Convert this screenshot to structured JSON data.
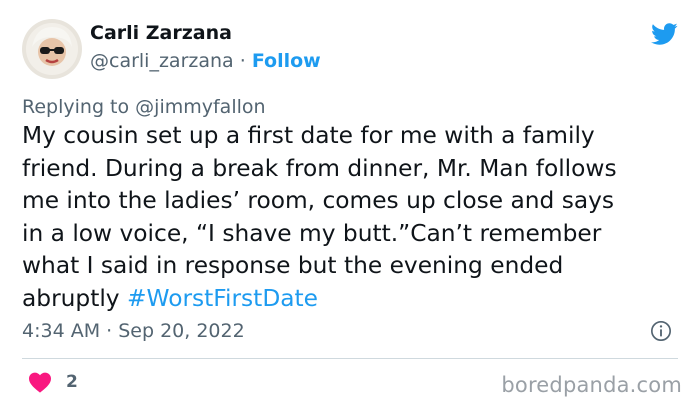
{
  "author": {
    "name": "Carli Zarzana",
    "handle": "@carli_zarzana",
    "separator": "·",
    "follow_label": "Follow"
  },
  "reply": {
    "prefix": "Replying to",
    "mention": "@jimmyfallon"
  },
  "tweet": {
    "text": "My cousin set up a first date for me with a family\nfriend. During a break from dinner, Mr. Man follows\nme into the ladies’ room, comes up close and says\nin a low voice, “I shave my butt.”Can’t remember\nwhat I said in response but the evening ended\nabruptly ",
    "hashtag": "#WorstFirstDate"
  },
  "meta": {
    "timestamp": "4:34 AM · Sep 20, 2022",
    "like_count": "2"
  },
  "watermark": "boredpanda.com",
  "icons": {
    "brand": "twitter-bird-icon",
    "info": "info-icon",
    "like": "heart-icon"
  },
  "colors": {
    "accent": "#1d9bf0",
    "like": "#f91880",
    "secondary_text": "#536471",
    "primary_text": "#0f1419"
  }
}
